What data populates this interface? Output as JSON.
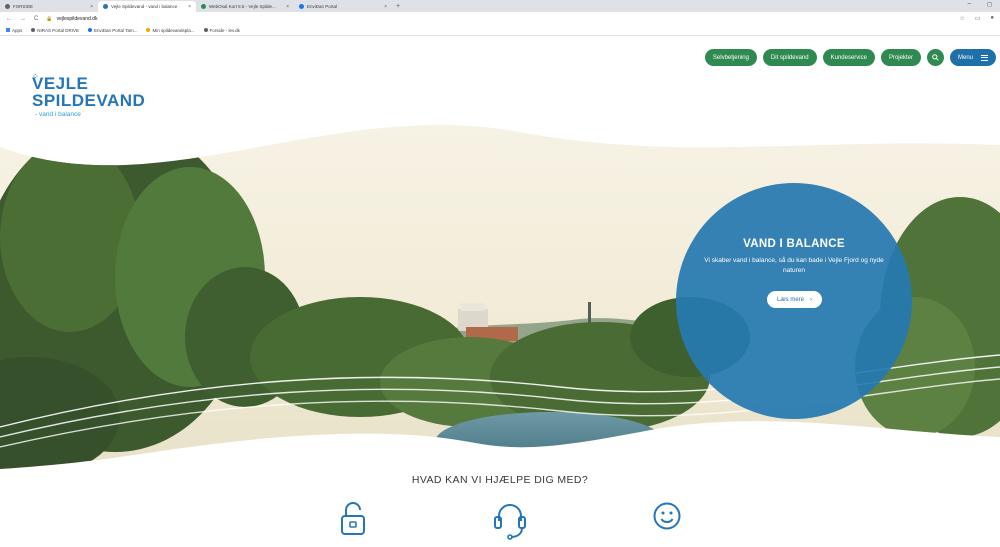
{
  "browser": {
    "tabs": [
      {
        "title": "FORSIDE",
        "active": false,
        "favicon_color": "#5f6368"
      },
      {
        "title": "Vejle Spildevand - vand i balance",
        "active": true,
        "favicon_color": "#2476b8"
      },
      {
        "title": "WebOsal Kort 8.5 - Vejle Spilde...",
        "active": false,
        "favicon_color": "#2f8a52"
      },
      {
        "title": "EnviDan Portal",
        "active": false,
        "favicon_color": "#1a73e8"
      }
    ],
    "new_tab": "+",
    "url": "vejlespildevand.dk",
    "bookmarks": [
      {
        "label": "Apps",
        "color": "#4285f4"
      },
      {
        "label": "NIRAS Portal DRIVE",
        "color": "#5f6368"
      },
      {
        "label": "EnviDan Portal Tam...",
        "color": "#1a73e8"
      },
      {
        "label": "Min spildevandspla...",
        "color": "#f2a600"
      },
      {
        "label": "Forside - lev.dk",
        "color": "#5f6368"
      }
    ]
  },
  "logo": {
    "line1": "VEJLE",
    "line2": "SPILDEVAND",
    "tagline": "- vand i balance"
  },
  "nav": {
    "items": [
      "Selvbetjening",
      "Dit spildevand",
      "Kundeservice",
      "Projekter"
    ],
    "menu_label": "Menu"
  },
  "hero": {
    "title": "VAND I BALANCE",
    "text": "Vi skaber vand i balance, så du kan bade i Vejle Fjord og nyde naturen",
    "button_label": "Læs mere"
  },
  "help": {
    "title": "HVAD KAN VI HJÆLPE DIG MED?",
    "icons": [
      "unlock-icon",
      "headset-icon",
      "smiley-icon"
    ]
  },
  "colors": {
    "brand_blue": "#2476b8",
    "nav_green": "#2f8a52",
    "menu_blue": "#1f6fa8"
  }
}
